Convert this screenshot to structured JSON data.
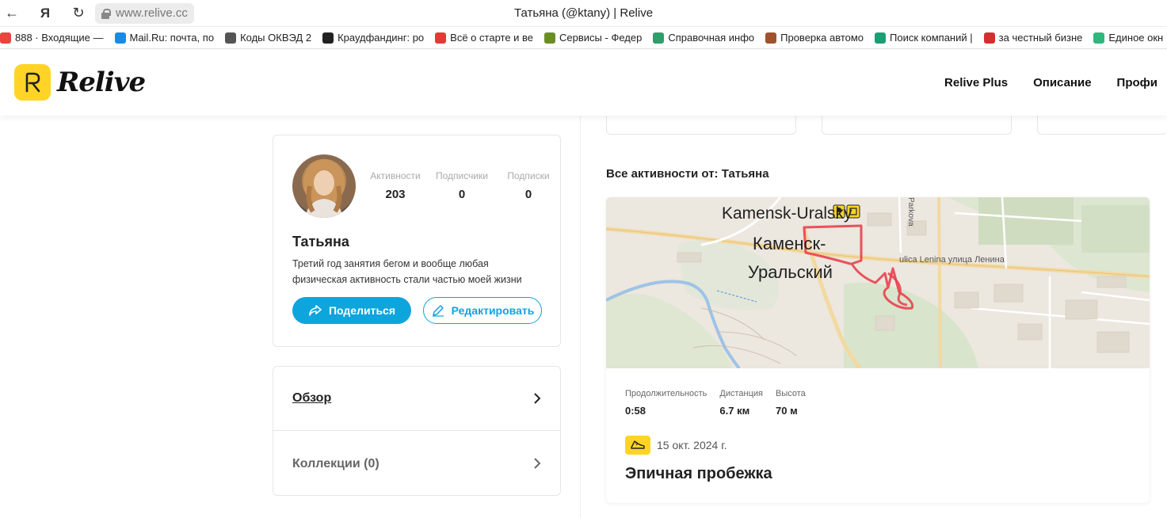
{
  "browser": {
    "url": "www.relive.cc",
    "tab_title": "Татьяна (@ktany) | Relive"
  },
  "bookmarks": [
    {
      "icon": "mail-icon",
      "color": "#e8453c",
      "label": "888 · Входящие —"
    },
    {
      "icon": "mailru-icon",
      "color": "#168de2",
      "label": "Mail.Ru: почта, по"
    },
    {
      "icon": "doc-icon",
      "color": "#555555",
      "label": "Коды ОКВЭД 2"
    },
    {
      "icon": "ruble-icon",
      "color": "#222222",
      "label": "Краудфандинг: ро"
    },
    {
      "icon": "r-icon",
      "color": "#e53935",
      "label": "Всё о старте и ве"
    },
    {
      "icon": "emblem-icon",
      "color": "#6b8e23",
      "label": "Сервисы - Федер"
    },
    {
      "icon": "leaf-icon",
      "color": "#2e9e6a",
      "label": "Справочная инфо"
    },
    {
      "icon": "badge-icon",
      "color": "#a0522d",
      "label": "Проверка автомо"
    },
    {
      "icon": "search-company-icon",
      "color": "#1b9e77",
      "label": "Поиск компаний |"
    },
    {
      "icon": "za-icon",
      "color": "#d32f2f",
      "label": "за честный бизне"
    },
    {
      "icon": "play-icon",
      "color": "#2fb87d",
      "label": "Единое окн"
    }
  ],
  "site": {
    "logo_text": "Relive",
    "nav": [
      "Relive Plus",
      "Описание",
      "Профи"
    ]
  },
  "profile": {
    "stats": [
      {
        "label": "Активности",
        "value": "203"
      },
      {
        "label": "Подписчики",
        "value": "0"
      },
      {
        "label": "Подписки",
        "value": "0"
      }
    ],
    "name": "Татьяна",
    "bio": "Третий год занятия бегом и вообще любая физическая активность стали частью моей жизни",
    "share_label": "Поделиться",
    "edit_label": "Редактировать"
  },
  "menu": {
    "overview": "Обзор",
    "collections": "Коллекции (0)"
  },
  "activities": {
    "heading": "Все активности от: Татьяна",
    "items": [
      {
        "map_labels": {
          "city_en": "Kamensk-Uralsky",
          "city_ru_1": "Каменск-",
          "city_ru_2": "Уральский",
          "street": "ulica Lenina улица Ленина",
          "street2": "Parkova"
        },
        "metrics": [
          {
            "label": "Продолжительность",
            "value": "0:58"
          },
          {
            "label": "Дистанция",
            "value": "6.7 км"
          },
          {
            "label": "Высота",
            "value": "70 м"
          }
        ],
        "date": "15 окт. 2024 г.",
        "title": "Эпичная пробежка"
      }
    ]
  },
  "colors": {
    "accent": "#0ea5dd",
    "brand_yellow": "#ffd426",
    "route": "#e8414e"
  }
}
